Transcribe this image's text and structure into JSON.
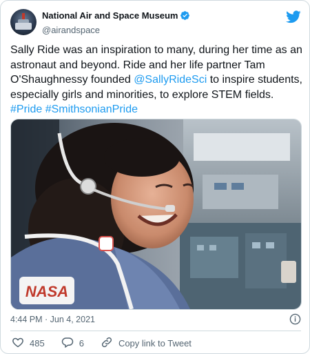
{
  "account": {
    "display_name": "National Air and Space Museum",
    "handle": "@airandspace",
    "verified": true
  },
  "tweet": {
    "text_parts": [
      {
        "text": "Sally Ride was an inspiration to many, during her time as an astronaut and beyond. Ride and her life partner Tam O'Shaughnessy founded ",
        "type": "plain"
      },
      {
        "text": "@SallyRideSci",
        "type": "link"
      },
      {
        "text": " to inspire students, especially girls and minorities, to explore STEM fields. ",
        "type": "plain"
      },
      {
        "text": "#Pride",
        "type": "link"
      },
      {
        "text": " ",
        "type": "plain"
      },
      {
        "text": "#SmithsonianPride",
        "type": "link"
      }
    ],
    "timestamp": "4:44 PM · Jun 4, 2021"
  },
  "media": {
    "patch_text": "NASA"
  },
  "actions": {
    "likes": "485",
    "replies": "6",
    "copy_label": "Copy link to Tweet"
  },
  "icons": {
    "brand": "twitter-bird-icon",
    "verified": "verified-badge-icon",
    "info": "info-icon",
    "like": "heart-icon",
    "reply": "reply-icon",
    "copy": "link-icon"
  },
  "colors": {
    "accent": "#1d9bf0",
    "text": "#0f1419",
    "secondary": "#536471",
    "border": "#cfd9de"
  }
}
